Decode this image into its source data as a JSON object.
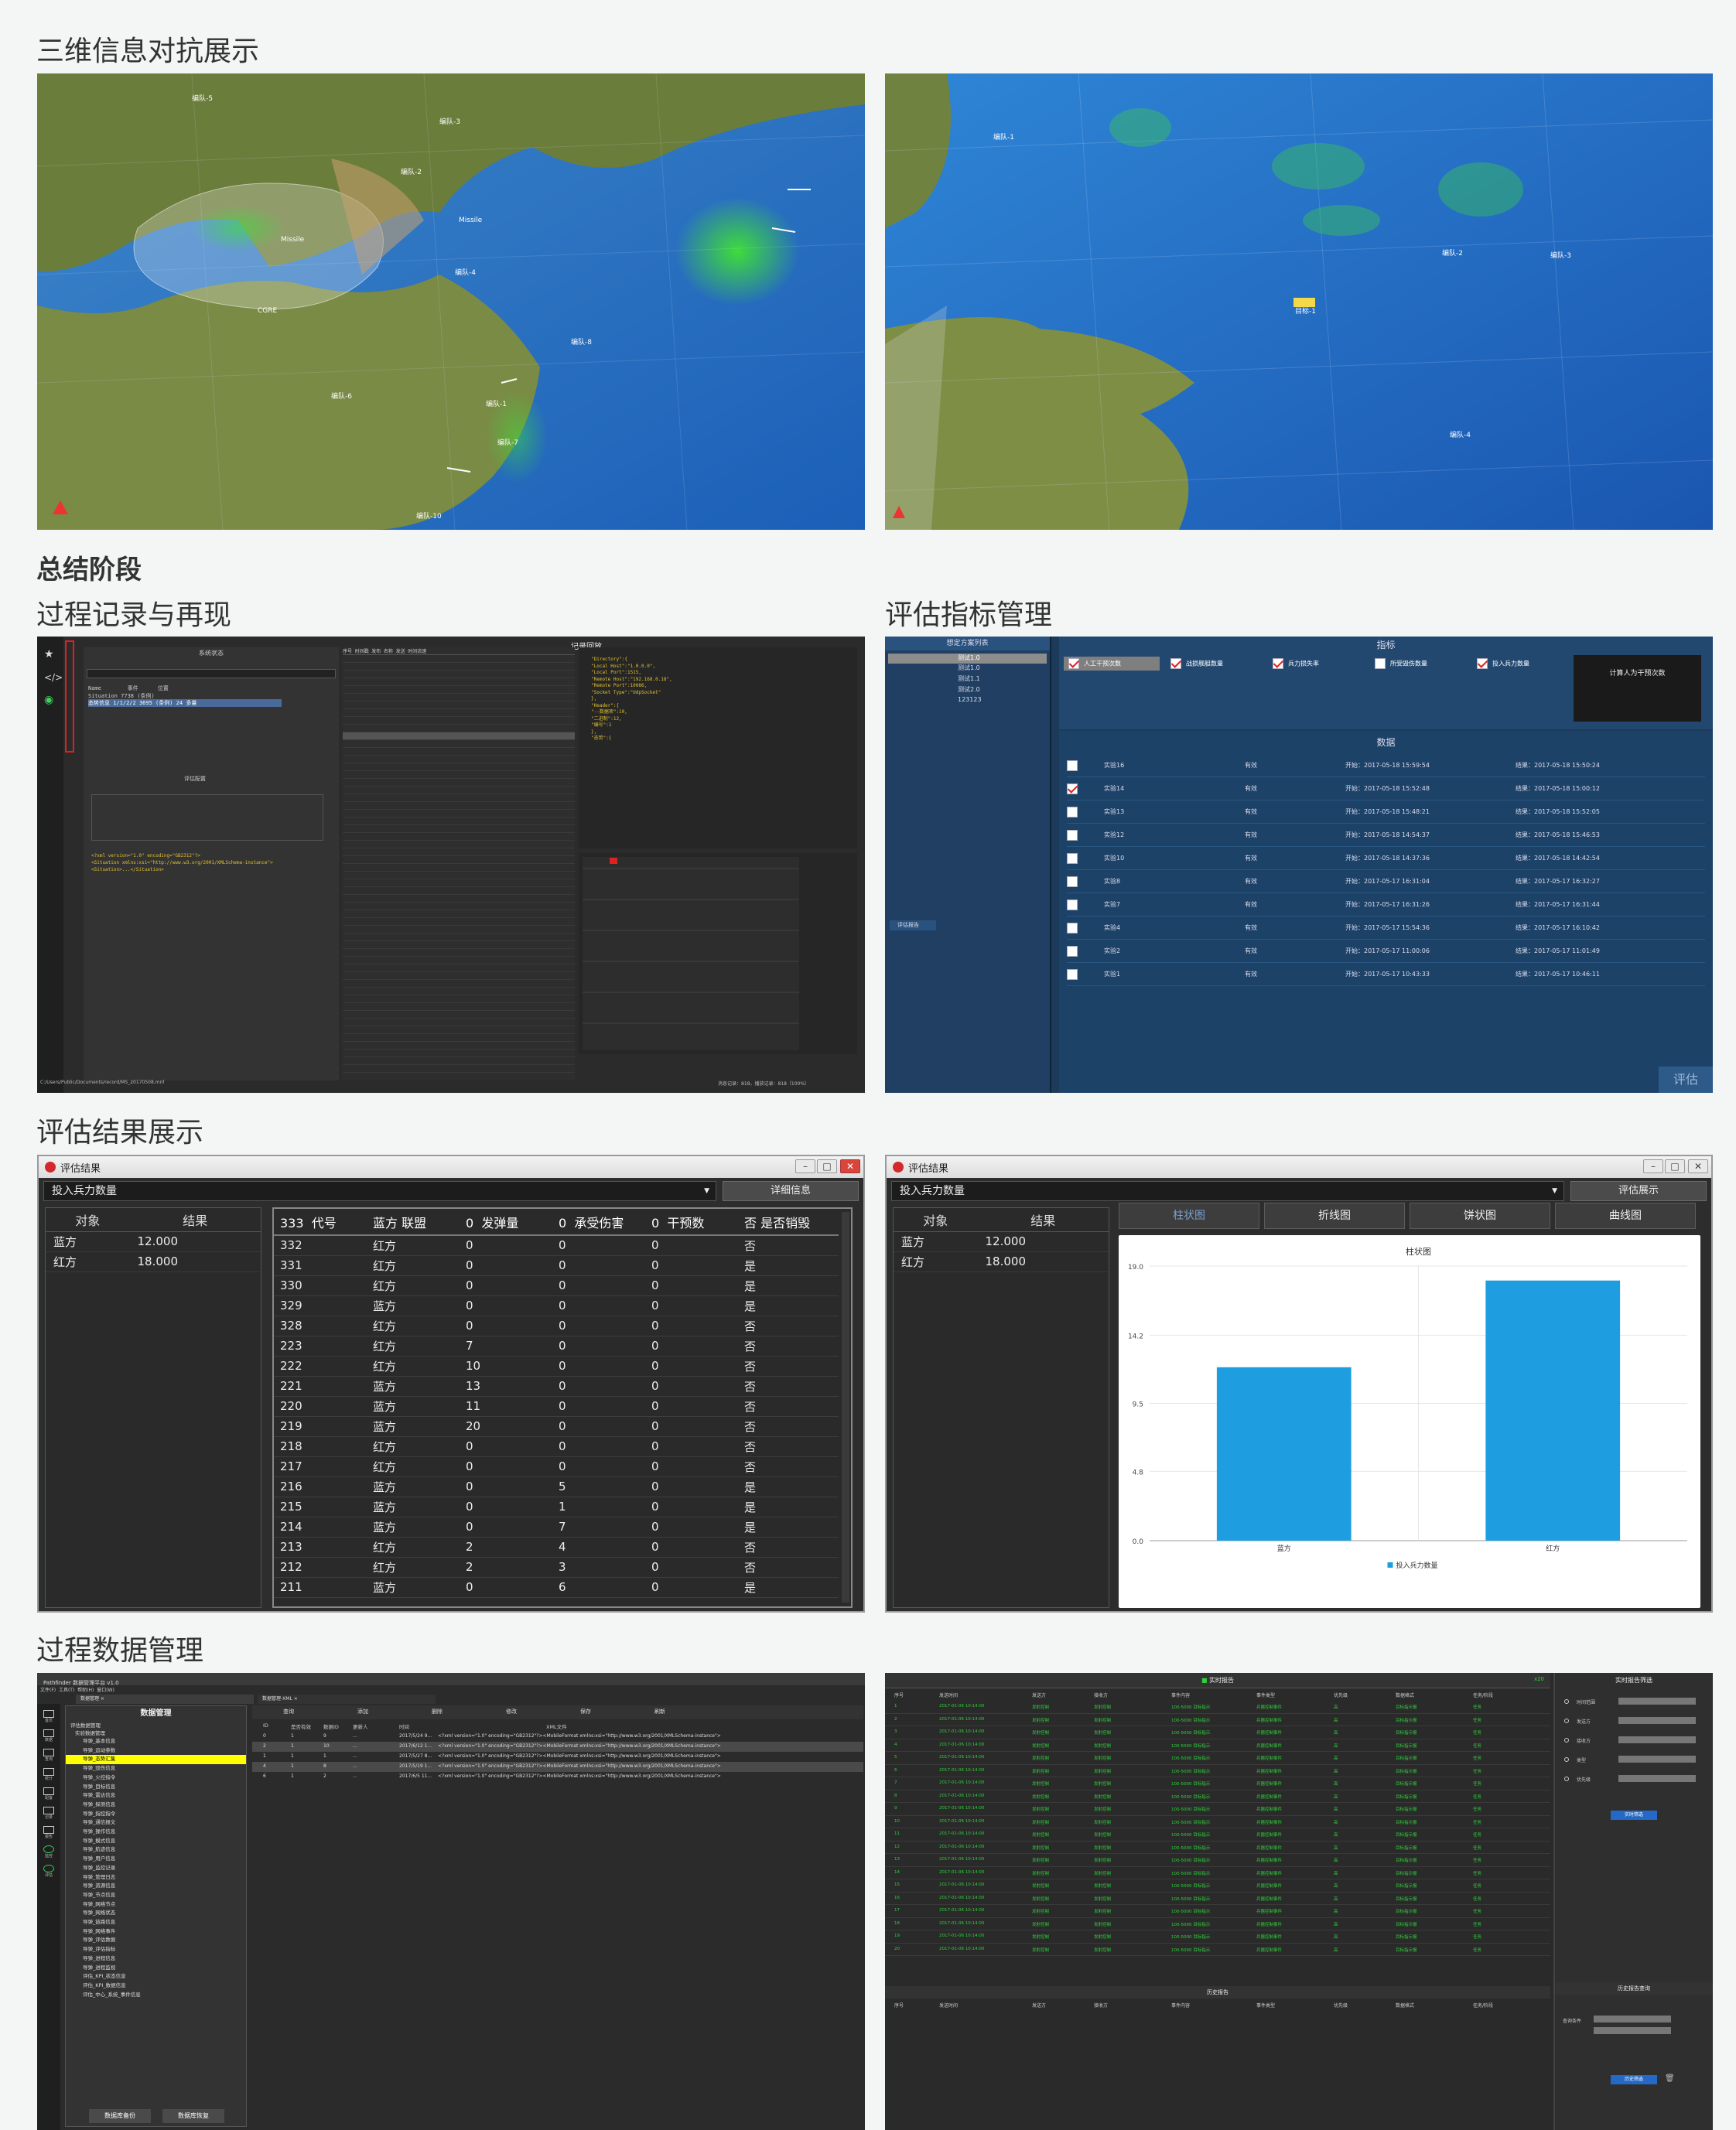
{
  "headings": {
    "three_d": "三维信息对抗展示",
    "summary": "总结阶段",
    "process_record": "过程记录与再现",
    "metric_mgmt": "评估指标管理",
    "eval_result": "评估结果展示",
    "data_mgmt": "过程数据管理"
  },
  "map1": {
    "labels": [
      "编队-5",
      "编队-3",
      "编队-2",
      "Missile",
      "Missile",
      "CGRE",
      "编队-8",
      "编队-6",
      "编队-4",
      "编队-1",
      "编队-7",
      "编队-10"
    ]
  },
  "map2": {
    "labels": [
      "编队-1",
      "编队-2",
      "编队-3",
      "编队-4",
      "目标-1"
    ]
  },
  "record": {
    "title": "记录回放",
    "left_title": "系统状态",
    "tree_cols": [
      "Name",
      "事件",
      "位置"
    ],
    "tree_rows": [
      [
        "Situation",
        "7738 (条例)",
        ""
      ],
      [
        "态势信息 1/1/2/2",
        "3695 (条例)",
        "24 多量"
      ]
    ],
    "filter_label": "评估配置",
    "cols": [
      "序号",
      "时间戳",
      "发布",
      "名称",
      "发送",
      "时间流速"
    ],
    "xml_lines": [
      "<?xml version=\"1.0\" encoding=\"GB2312\"?>",
      "<Situation xmlns:xsi=\"http://www.w3.org/2001/XMLSchema-instance\">",
      "  <Situation>...</Situation>"
    ],
    "json_lines": [
      "\"Directory\":{",
      "  \"Local Host\":\"1.0.0.0\",",
      "  \"Local Port\":1515,",
      "  \"Remote Host\":\"192.168.0.18\",",
      "  \"Remote Port\":10086,",
      "  \"Socket Type\":\"UdpSocket\"",
      "},",
      "\"Header\":{",
      "  \"--数据项\":10,",
      "  \"二进制\":12,",
      "  \"编号\":1",
      "},",
      "\"态势\":{"
    ],
    "status": "消息记录：818，播放记录：818（100%）",
    "path": "C:/Users/Public/Documents/record/MS_20170508.mnf"
  },
  "metrics": {
    "left_title": "想定方案列表",
    "schemes": [
      "测试1.0",
      "测试1.0",
      "测试1.1",
      "测试2.0",
      "123123"
    ],
    "left_btn": "评估报告",
    "header_title": "指标",
    "indicators": [
      {
        "label": "人工干预次数",
        "on": true
      },
      {
        "label": "战损舰艇数量",
        "on": true
      },
      {
        "label": "兵力损失率",
        "on": true
      },
      {
        "label": "所受毁伤数量",
        "on": false
      },
      {
        "label": "投入兵力数量",
        "on": true
      }
    ],
    "calc_btn": "计算人为干预次数",
    "data_title": "数据",
    "rows": [
      {
        "name": "实验16",
        "status": "有效",
        "start": "开始：2017-05-18 15:59:54",
        "end": "结果：2017-05-18 15:50:24",
        "on": false
      },
      {
        "name": "实验14",
        "status": "有效",
        "start": "开始：2017-05-18 15:52:48",
        "end": "结果：2017-05-18 15:00:12",
        "on": true
      },
      {
        "name": "实验13",
        "status": "有效",
        "start": "开始：2017-05-18 15:48:21",
        "end": "结果：2017-05-18 15:52:05",
        "on": false
      },
      {
        "name": "实验12",
        "status": "有效",
        "start": "开始：2017-05-18 14:54:37",
        "end": "结果：2017-05-18 15:46:53",
        "on": false
      },
      {
        "name": "实验10",
        "status": "有效",
        "start": "开始：2017-05-18 14:37:36",
        "end": "结果：2017-05-18 14:42:54",
        "on": false
      },
      {
        "name": "实验8",
        "status": "有效",
        "start": "开始：2017-05-17 16:31:04",
        "end": "结果：2017-05-17 16:32:27",
        "on": false
      },
      {
        "name": "实验7",
        "status": "有效",
        "start": "开始：2017-05-17 16:31:26",
        "end": "结果：2017-05-17 16:31:44",
        "on": false
      },
      {
        "name": "实验4",
        "status": "有效",
        "start": "开始：2017-05-17 15:54:36",
        "end": "结果：2017-05-17 16:10:42",
        "on": false
      },
      {
        "name": "实验2",
        "status": "有效",
        "start": "开始：2017-05-17 11:00:06",
        "end": "结果：2017-05-17 11:01:49",
        "on": false
      },
      {
        "name": "实验1",
        "status": "有效",
        "start": "开始：2017-05-17 10:43:33",
        "end": "结果：2017-05-17 10:46:11",
        "on": false
      }
    ],
    "eval_btn": "评估"
  },
  "result_left": {
    "title": "评估结果",
    "select": "投入兵力数量",
    "btn": "详细信息",
    "obj_headers": [
      "对象",
      "结果"
    ],
    "objs": [
      [
        "蓝方",
        "12.000"
      ],
      [
        "红方",
        "18.000"
      ]
    ],
    "table_headers": [
      "333",
      "代号",
      "蓝方",
      "联盟",
      "0",
      "发弹量",
      "0",
      "承受伤害",
      "0",
      "干预数",
      "否",
      "是否销毁"
    ],
    "rows": [
      [
        "332",
        "红方",
        "0",
        "0",
        "0",
        "否"
      ],
      [
        "331",
        "红方",
        "0",
        "0",
        "0",
        "是"
      ],
      [
        "330",
        "红方",
        "0",
        "0",
        "0",
        "是"
      ],
      [
        "329",
        "蓝方",
        "0",
        "0",
        "0",
        "是"
      ],
      [
        "328",
        "红方",
        "0",
        "0",
        "0",
        "否"
      ],
      [
        "223",
        "红方",
        "7",
        "0",
        "0",
        "否"
      ],
      [
        "222",
        "红方",
        "10",
        "0",
        "0",
        "否"
      ],
      [
        "221",
        "蓝方",
        "13",
        "0",
        "0",
        "否"
      ],
      [
        "220",
        "蓝方",
        "11",
        "0",
        "0",
        "否"
      ],
      [
        "219",
        "蓝方",
        "20",
        "0",
        "0",
        "否"
      ],
      [
        "218",
        "红方",
        "0",
        "0",
        "0",
        "否"
      ],
      [
        "217",
        "红方",
        "0",
        "0",
        "0",
        "否"
      ],
      [
        "216",
        "蓝方",
        "0",
        "5",
        "0",
        "是"
      ],
      [
        "215",
        "蓝方",
        "0",
        "1",
        "0",
        "是"
      ],
      [
        "214",
        "蓝方",
        "0",
        "7",
        "0",
        "是"
      ],
      [
        "213",
        "红方",
        "2",
        "4",
        "0",
        "否"
      ],
      [
        "212",
        "红方",
        "2",
        "3",
        "0",
        "否"
      ],
      [
        "211",
        "蓝方",
        "0",
        "6",
        "0",
        "是"
      ]
    ]
  },
  "result_right": {
    "title": "评估结果",
    "select": "投入兵力数量",
    "btn": "评估展示",
    "obj_headers": [
      "对象",
      "结果"
    ],
    "objs": [
      [
        "蓝方",
        "12.000"
      ],
      [
        "红方",
        "18.000"
      ]
    ],
    "tabs": [
      "柱状图",
      "折线图",
      "饼状图",
      "曲线图"
    ]
  },
  "chart_data": {
    "type": "bar",
    "title": "柱状图",
    "categories": [
      "蓝方",
      "红方"
    ],
    "series": [
      {
        "name": "投入兵力数量",
        "values": [
          12,
          18
        ]
      }
    ],
    "ylim": [
      0,
      19
    ],
    "yticks": [
      "19.0",
      "14.2",
      "9.5",
      "4.8",
      "0.0"
    ],
    "color": "#1e9ee0"
  },
  "datamgmt": {
    "app_title": "Pathfinder 数据管理平台 v1.0",
    "menus": [
      "文件(F)",
      "工具(T)",
      "帮助(H)",
      "窗口(W)"
    ],
    "tab1": "数据管理 ×",
    "tab2": "数据管理-XML ×",
    "panel_title": "数据管理",
    "tree_root": "评估数据管理",
    "tree_sub": "实验数据管理",
    "tree_items": [
      "导弹_基本信息",
      "导弹_运动参数",
      "导弹_态势汇集",
      "导弹_毁伤信息",
      "导弹_火控指令",
      "导弹_目标信息",
      "导弹_雷达信息",
      "导弹_探测信息",
      "导弹_指控指令",
      "导弹_通信报文",
      "导弹_操作信息",
      "导弹_模式信息",
      "导弹_航迹信息",
      "导弹_用户信息",
      "导弹_监控记录",
      "导弹_管理日志",
      "导弹_资源信息",
      "导弹_节点信息",
      "导弹_网络节点",
      "导弹_网络状态",
      "导弹_链路信息",
      "导弹_网络事件",
      "导弹_评估数据",
      "导弹_评估指标",
      "导弹_进程信息",
      "导弹_进程监视",
      "评估_KPI_状态信息",
      "评估_KPI_数据信息",
      "评估_中心_系统_事件信息"
    ],
    "highlighted": 2,
    "toolbar": [
      "查询",
      "添加",
      "删除",
      "修改",
      "保存",
      "刷新"
    ],
    "cols": [
      "ID",
      "是否有效",
      "数据ID",
      "更新人",
      "时间",
      "XML文件"
    ],
    "rows": [
      [
        "0",
        "1",
        "9",
        "...",
        "2017/5/24 9...",
        "<?xml version=\"1.0\" encoding=\"GB2312\"?><MobileFormat xmlns:xsi=\"http://www.w3.org/2001/XMLSchema-instance\">"
      ],
      [
        "2",
        "1",
        "10",
        "...",
        "2017/6/12 1...",
        "<?xml version=\"1.0\" encoding=\"GB2312\"?><MobileFormat xmlns:xsi=\"http://www.w3.org/2001/XMLSchema-instance\">"
      ],
      [
        "1",
        "1",
        "1",
        "...",
        "2017/5/27 8...",
        "<?xml version=\"1.0\" encoding=\"GB2312\"?><MobileFormat xmlns:xsi=\"http://www.w3.org/2001/XMLSchema-instance\">"
      ],
      [
        "4",
        "1",
        "8",
        "...",
        "2017/5/19 1...",
        "<?xml version=\"1.0\" encoding=\"GB2312\"?><MobileFormat xmlns:xsi=\"http://www.w3.org/2001/XMLSchema-instance\">"
      ],
      [
        "6",
        "1",
        "2",
        "...",
        "2017/6/5 11...",
        "<?xml version=\"1.0\" encoding=\"GB2312\"?><MobileFormat xmlns:xsi=\"http://www.w3.org/2001/XMLSchema-instance\">"
      ]
    ],
    "btn_backup": "数据库备份",
    "btn_restore": "数据库恢复",
    "side_icons": [
      "首页",
      "数据",
      "查询",
      "统计",
      "配置",
      "记录",
      "报告",
      "监控",
      "评估"
    ]
  },
  "report": {
    "title": "实时报告",
    "count": "x20",
    "cols": [
      "序号",
      "发送时间",
      "发送方",
      "接收方",
      "事件内容",
      "事件类型",
      "优先级",
      "数据格式",
      "任务/阶段"
    ],
    "rows_count": 20,
    "row_time": "2017-01-06 10:14:00",
    "row_from": "发射控制",
    "row_to": "发射控制",
    "row_event": "100-5000 目标指示",
    "row_type": "兵器控制事件",
    "row_pri": "高",
    "row_fmt": "目标指示报",
    "row_task": "任务",
    "history_title": "历史报告",
    "right_title": "实时报告筛选",
    "filters": [
      "时间范围",
      "发送方",
      "接收方",
      "类型",
      "优先级"
    ],
    "filter_btn": "实时筛选",
    "history_query": "历史报告查询",
    "query_label": "查询条件",
    "query_btn": "历史筛选"
  }
}
